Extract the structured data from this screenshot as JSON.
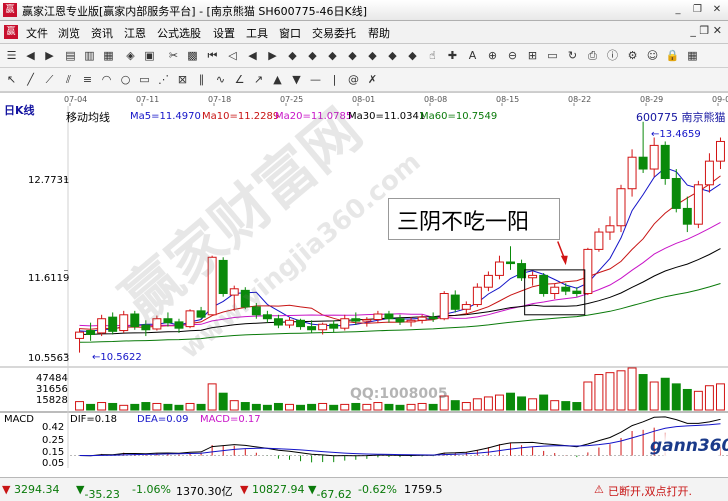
{
  "window": {
    "title": "赢家江恩专业版[赢家内部服务平台] - [南京熊猫  SH600775-46日K线]"
  },
  "menu": [
    "文件",
    "浏览",
    "资讯",
    "江恩",
    "公式选股",
    "设置",
    "工具",
    "窗口",
    "交易委托",
    "帮助"
  ],
  "chart_data": {
    "type": "candlestick",
    "period_label": "日K线",
    "stock_code": "600775",
    "stock_name": "南京熊猫",
    "indicator_title": "移动均线",
    "ma_legend": [
      {
        "name": "Ma5",
        "value": "11.4970",
        "color": "#1414c8"
      },
      {
        "name": "Ma10",
        "value": "11.2289",
        "color": "#c81414"
      },
      {
        "name": "Ma20",
        "value": "11.0785",
        "color": "#c814c8"
      },
      {
        "name": "Ma30",
        "value": "11.0341",
        "color": "#000000"
      },
      {
        "name": "Ma60",
        "value": "10.7549",
        "color": "#0a7a0a"
      }
    ],
    "date_ticks": [
      "07-04",
      "07-11",
      "07-18",
      "07-25",
      "08-01",
      "08-08",
      "08-15",
      "08-22",
      "08-29",
      "09-0"
    ],
    "y_ticks": [
      12.7731,
      11.6119,
      10.5563
    ],
    "low_marker": "10.5622",
    "high_marker": "13.4659",
    "annotation": "三阴不吃一阳",
    "volume_ticks": [
      47484,
      31656,
      15828
    ],
    "candles": [
      {
        "o": 10.75,
        "h": 10.88,
        "l": 10.57,
        "c": 10.83
      },
      {
        "o": 10.85,
        "h": 10.95,
        "l": 10.72,
        "c": 10.8
      },
      {
        "o": 10.82,
        "h": 11.05,
        "l": 10.78,
        "c": 11.0
      },
      {
        "o": 11.02,
        "h": 11.08,
        "l": 10.8,
        "c": 10.84
      },
      {
        "o": 10.85,
        "h": 11.1,
        "l": 10.82,
        "c": 11.05
      },
      {
        "o": 11.06,
        "h": 11.1,
        "l": 10.86,
        "c": 10.9
      },
      {
        "o": 10.92,
        "h": 10.98,
        "l": 10.78,
        "c": 10.86
      },
      {
        "o": 10.87,
        "h": 11.04,
        "l": 10.85,
        "c": 11.0
      },
      {
        "o": 11.0,
        "h": 11.08,
        "l": 10.9,
        "c": 10.95
      },
      {
        "o": 10.96,
        "h": 11.0,
        "l": 10.82,
        "c": 10.88
      },
      {
        "o": 10.9,
        "h": 11.12,
        "l": 10.88,
        "c": 11.1
      },
      {
        "o": 11.1,
        "h": 11.15,
        "l": 11.0,
        "c": 11.02
      },
      {
        "o": 11.05,
        "h": 11.8,
        "l": 11.05,
        "c": 11.78
      },
      {
        "o": 11.74,
        "h": 11.78,
        "l": 11.28,
        "c": 11.32
      },
      {
        "o": 11.3,
        "h": 11.42,
        "l": 11.1,
        "c": 11.38
      },
      {
        "o": 11.36,
        "h": 11.4,
        "l": 11.12,
        "c": 11.15
      },
      {
        "o": 11.15,
        "h": 11.2,
        "l": 11.0,
        "c": 11.05
      },
      {
        "o": 11.05,
        "h": 11.1,
        "l": 10.95,
        "c": 11.0
      },
      {
        "o": 11.0,
        "h": 11.05,
        "l": 10.88,
        "c": 10.92
      },
      {
        "o": 10.92,
        "h": 11.02,
        "l": 10.88,
        "c": 10.98
      },
      {
        "o": 10.98,
        "h": 11.0,
        "l": 10.86,
        "c": 10.9
      },
      {
        "o": 10.9,
        "h": 10.98,
        "l": 10.82,
        "c": 10.86
      },
      {
        "o": 10.86,
        "h": 10.95,
        "l": 10.8,
        "c": 10.93
      },
      {
        "o": 10.93,
        "h": 10.98,
        "l": 10.83,
        "c": 10.88
      },
      {
        "o": 10.88,
        "h": 11.05,
        "l": 10.85,
        "c": 11.0
      },
      {
        "o": 11.0,
        "h": 11.08,
        "l": 10.92,
        "c": 10.97
      },
      {
        "o": 10.97,
        "h": 11.02,
        "l": 10.9,
        "c": 10.99
      },
      {
        "o": 10.99,
        "h": 11.1,
        "l": 10.95,
        "c": 11.06
      },
      {
        "o": 11.06,
        "h": 11.1,
        "l": 10.95,
        "c": 11.0
      },
      {
        "o": 11.0,
        "h": 11.05,
        "l": 10.92,
        "c": 10.96
      },
      {
        "o": 10.96,
        "h": 11.02,
        "l": 10.9,
        "c": 10.98
      },
      {
        "o": 10.98,
        "h": 11.05,
        "l": 10.94,
        "c": 11.02
      },
      {
        "o": 11.02,
        "h": 11.08,
        "l": 10.96,
        "c": 11.0
      },
      {
        "o": 11.0,
        "h": 11.35,
        "l": 10.98,
        "c": 11.32
      },
      {
        "o": 11.3,
        "h": 11.36,
        "l": 11.08,
        "c": 11.12
      },
      {
        "o": 11.12,
        "h": 11.22,
        "l": 11.05,
        "c": 11.18
      },
      {
        "o": 11.18,
        "h": 11.45,
        "l": 11.15,
        "c": 11.4
      },
      {
        "o": 11.4,
        "h": 11.6,
        "l": 11.35,
        "c": 11.55
      },
      {
        "o": 11.55,
        "h": 11.8,
        "l": 11.5,
        "c": 11.72
      },
      {
        "o": 11.72,
        "h": 11.92,
        "l": 11.62,
        "c": 11.7
      },
      {
        "o": 11.7,
        "h": 11.75,
        "l": 11.48,
        "c": 11.52
      },
      {
        "o": 11.52,
        "h": 11.6,
        "l": 11.42,
        "c": 11.55
      },
      {
        "o": 11.55,
        "h": 11.58,
        "l": 11.28,
        "c": 11.32
      },
      {
        "o": 11.32,
        "h": 11.45,
        "l": 11.25,
        "c": 11.4
      },
      {
        "o": 11.4,
        "h": 11.45,
        "l": 11.3,
        "c": 11.35
      },
      {
        "o": 11.35,
        "h": 11.4,
        "l": 11.28,
        "c": 11.32
      },
      {
        "o": 11.32,
        "h": 11.9,
        "l": 11.3,
        "c": 11.88
      },
      {
        "o": 11.88,
        "h": 12.15,
        "l": 11.85,
        "c": 12.1
      },
      {
        "o": 12.1,
        "h": 12.3,
        "l": 12.0,
        "c": 12.18
      },
      {
        "o": 12.18,
        "h": 12.7,
        "l": 12.1,
        "c": 12.65
      },
      {
        "o": 12.65,
        "h": 13.15,
        "l": 12.55,
        "c": 13.05
      },
      {
        "o": 13.05,
        "h": 13.5,
        "l": 12.85,
        "c": 12.9
      },
      {
        "o": 12.9,
        "h": 13.3,
        "l": 12.8,
        "c": 13.2
      },
      {
        "o": 13.2,
        "h": 13.25,
        "l": 12.7,
        "c": 12.78
      },
      {
        "o": 12.78,
        "h": 12.9,
        "l": 12.35,
        "c": 12.4
      },
      {
        "o": 12.4,
        "h": 12.55,
        "l": 12.1,
        "c": 12.2
      },
      {
        "o": 12.2,
        "h": 12.75,
        "l": 12.15,
        "c": 12.7
      },
      {
        "o": 12.7,
        "h": 13.1,
        "l": 12.6,
        "c": 13.0
      },
      {
        "o": 13.0,
        "h": 13.3,
        "l": 12.9,
        "c": 13.25
      }
    ],
    "volumes": [
      9,
      6,
      8,
      7,
      5,
      6,
      8,
      7,
      6,
      5,
      7,
      6,
      28,
      18,
      10,
      8,
      6,
      5,
      7,
      6,
      5,
      6,
      7,
      5,
      6,
      7,
      6,
      8,
      6,
      5,
      6,
      7,
      6,
      15,
      10,
      8,
      12,
      14,
      16,
      18,
      14,
      12,
      16,
      10,
      9,
      8,
      30,
      38,
      40,
      42,
      45,
      38,
      30,
      34,
      28,
      22,
      20,
      26,
      28
    ],
    "macd": {
      "title": "MACD",
      "dif": "DIF=0.18",
      "dea": "DEA=0.09",
      "macd": "MACD=0.17",
      "y_ticks": [
        "0.42",
        "0.25",
        "0.15",
        "0.05"
      ]
    }
  },
  "watermarks": {
    "main": "赢家财富网",
    "url": "www.yingjia360.com",
    "qq": "QQ:1008005",
    "logo": "gann360"
  },
  "statusbar": {
    "sh_index": "3294.34",
    "sh_change": "-35.23",
    "sh_pct": "-1.06%",
    "sh_amount": "1370.30亿",
    "sz_index": "10827.94",
    "sz_change": "-67.62",
    "sz_pct": "-0.62%",
    "sz_amount": "1759.5",
    "connection": "已断开,双点打开."
  }
}
